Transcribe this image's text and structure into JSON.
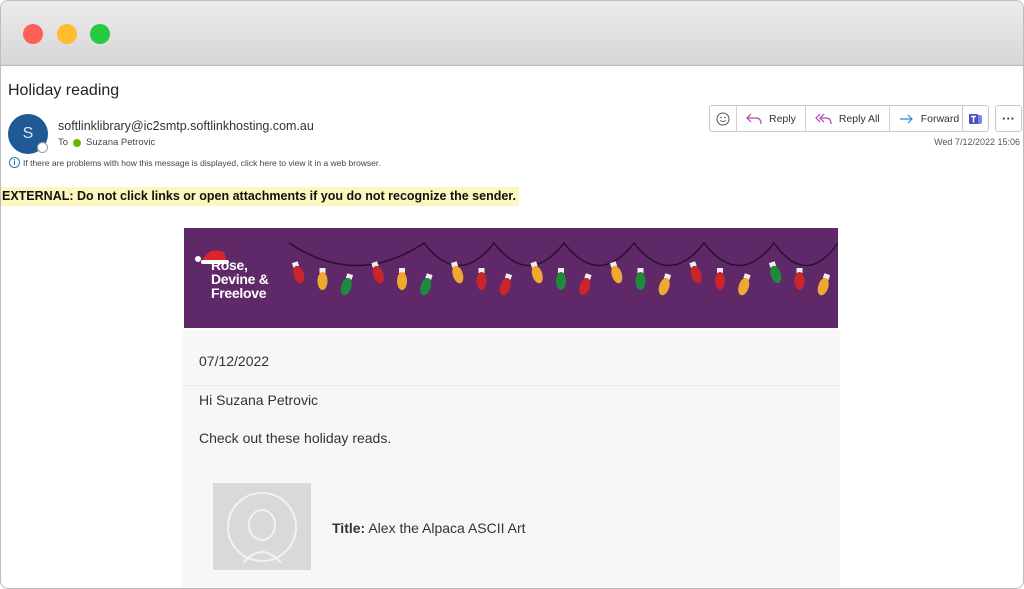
{
  "window": {
    "controls": {
      "close": "#fe5f57",
      "minimize": "#febc2e",
      "maximize": "#28c840"
    }
  },
  "email": {
    "subject": "Holiday reading",
    "avatar_initial": "S",
    "sender": "softlinklibrary@ic2smtp.softlinkhosting.com.au",
    "to_label": "To",
    "recipient": "Suzana Petrovic",
    "info_notice": "If there are problems with how this message is displayed, click here to view it in a web browser.",
    "external_warning": "EXTERNAL: Do not click links or open attachments if you do not recognize the sender.",
    "date": "Wed 7/12/2022 15:06"
  },
  "toolbar": {
    "emoji_icon": "smiley-icon",
    "reply": "Reply",
    "reply_all": "Reply All",
    "forward": "Forward",
    "teams_icon": "teams-icon",
    "more_icon": "more-icon"
  },
  "content": {
    "banner_colors": {
      "background": "#5f2868"
    },
    "logo_lines": [
      "Rose,",
      "Devine &",
      "Freelove"
    ],
    "date": "07/12/2022",
    "greeting": "Hi Suzana Petrovic",
    "intro": "Check out these holiday reads.",
    "items": [
      {
        "title_label": "Title:",
        "title": "Alex the Alpaca ASCII Art"
      }
    ]
  }
}
